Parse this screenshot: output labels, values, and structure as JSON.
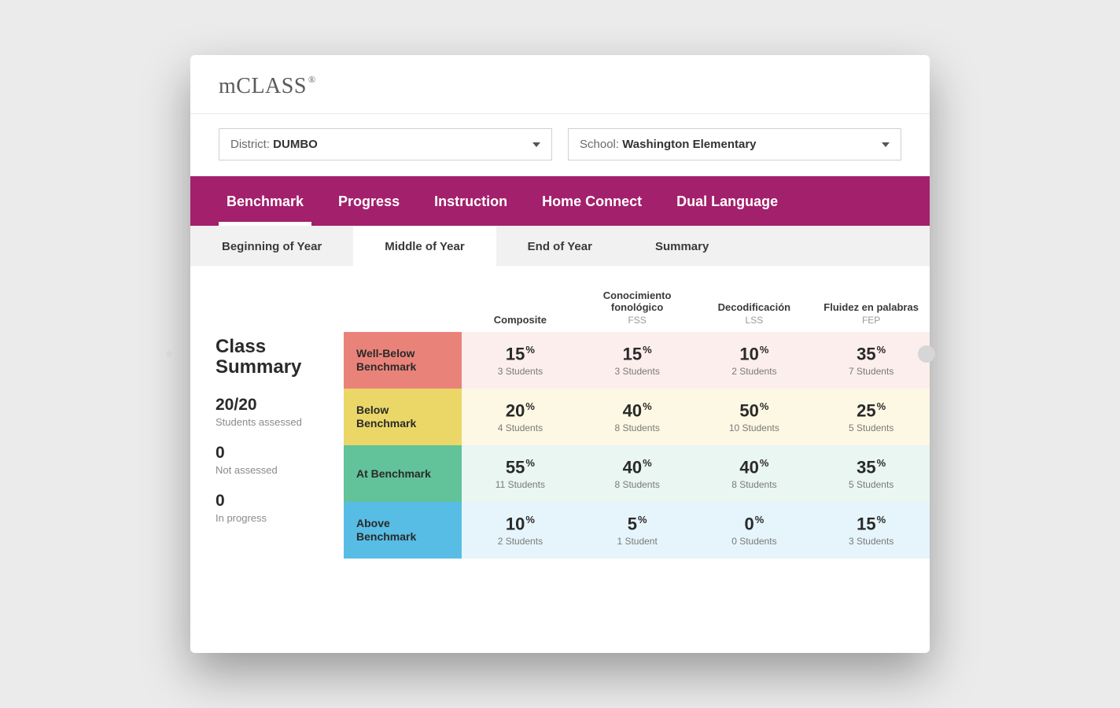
{
  "brand": "mCLASS",
  "brand_mark": "®",
  "filters": {
    "district": {
      "label": "District: ",
      "value": "DUMBO"
    },
    "school": {
      "label": "School: ",
      "value": "Washington Elementary"
    }
  },
  "nav": [
    {
      "label": "Benchmark",
      "active": true
    },
    {
      "label": "Progress",
      "active": false
    },
    {
      "label": "Instruction",
      "active": false
    },
    {
      "label": "Home Connect",
      "active": false
    },
    {
      "label": "Dual Language",
      "active": false
    }
  ],
  "sub_tabs": [
    {
      "label": "Beginning of Year",
      "active": false
    },
    {
      "label": "Middle of Year",
      "active": true
    },
    {
      "label": "End of Year",
      "active": false
    },
    {
      "label": "Summary",
      "active": false
    }
  ],
  "summary": {
    "title": "Class Summary",
    "assessed": {
      "value": "20/20",
      "label": "Students assessed"
    },
    "not_assessed": {
      "value": "0",
      "label": "Not assessed"
    },
    "in_progress": {
      "value": "0",
      "label": "In progress"
    }
  },
  "columns": [
    {
      "title": "Composite",
      "sub": ""
    },
    {
      "title": "Conocimiento fonológico",
      "sub": "FSS"
    },
    {
      "title": "Decodificación",
      "sub": "LSS"
    },
    {
      "title": "Fluidez en palabras",
      "sub": "FEP"
    }
  ],
  "benchmarks": [
    {
      "key": "wb",
      "label": "Well-Below Benchmark",
      "cells": [
        {
          "pct": "15",
          "students": "3 Students"
        },
        {
          "pct": "15",
          "students": "3 Students"
        },
        {
          "pct": "10",
          "students": "2 Students"
        },
        {
          "pct": "35",
          "students": "7 Students"
        }
      ]
    },
    {
      "key": "bb",
      "label": "Below Benchmark",
      "cells": [
        {
          "pct": "20",
          "students": "4 Students"
        },
        {
          "pct": "40",
          "students": "8 Students"
        },
        {
          "pct": "50",
          "students": "10 Students"
        },
        {
          "pct": "25",
          "students": "5 Students"
        }
      ]
    },
    {
      "key": "ab",
      "label": "At Benchmark",
      "cells": [
        {
          "pct": "55",
          "students": "11 Students"
        },
        {
          "pct": "40",
          "students": "8 Students"
        },
        {
          "pct": "40",
          "students": "8 Students"
        },
        {
          "pct": "35",
          "students": "5 Students"
        }
      ]
    },
    {
      "key": "av",
      "label": "Above Benchmark",
      "cells": [
        {
          "pct": "10",
          "students": "2 Students"
        },
        {
          "pct": "5",
          "students": "1 Student"
        },
        {
          "pct": "0",
          "students": "0 Students"
        },
        {
          "pct": "15",
          "students": "3 Students"
        }
      ]
    }
  ],
  "pct_symbol": "%"
}
